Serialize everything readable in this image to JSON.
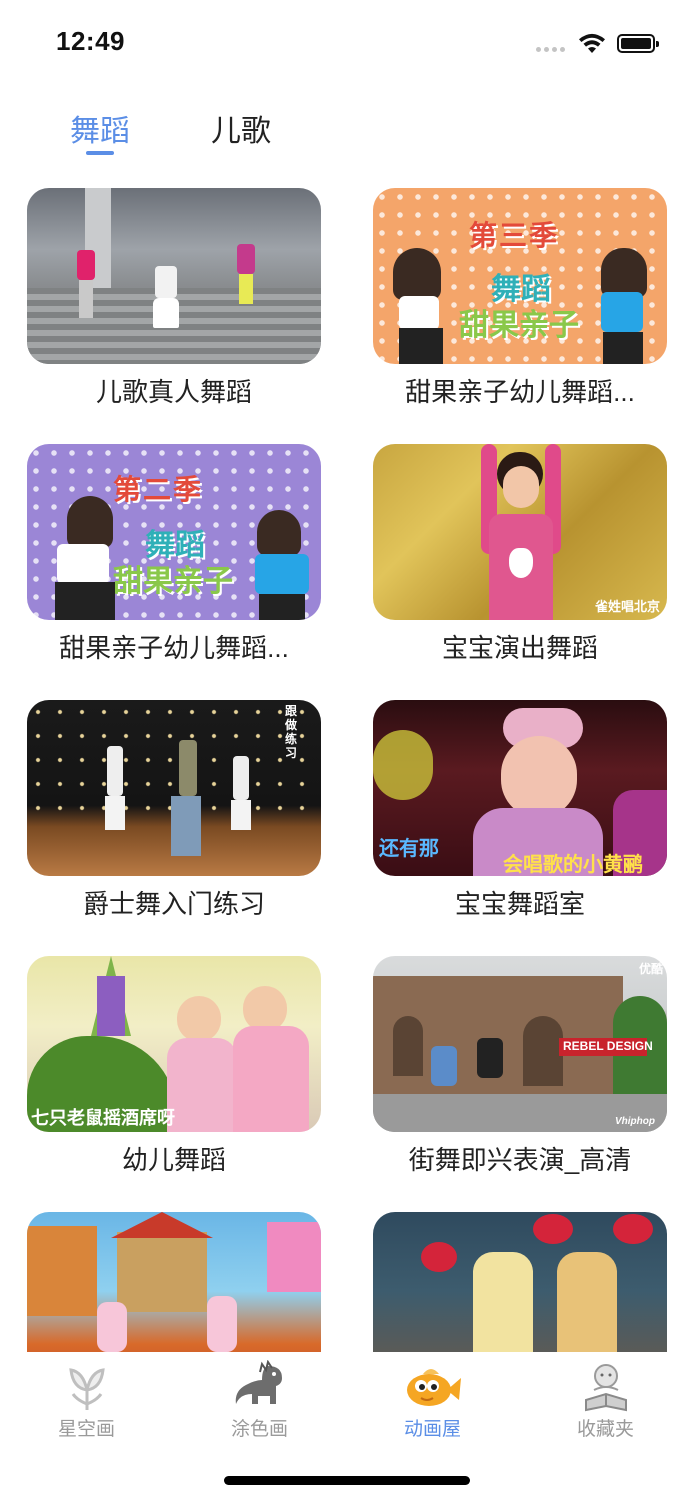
{
  "status_bar": {
    "time": "12:49"
  },
  "tabs": [
    {
      "label": "舞蹈",
      "active": true
    },
    {
      "label": "儿歌",
      "active": false
    }
  ],
  "videos": [
    {
      "title": "儿歌真人舞蹈"
    },
    {
      "title": "甜果亲子幼儿舞蹈...",
      "overlay": [
        "第三季",
        "舞蹈",
        "甜果亲子"
      ]
    },
    {
      "title": "甜果亲子幼儿舞蹈...",
      "overlay": [
        "第二季",
        "舞蹈",
        "甜果亲子"
      ]
    },
    {
      "title": "宝宝演出舞蹈",
      "overlay": [
        "雀姓唱北京"
      ]
    },
    {
      "title": "爵士舞入门练习",
      "overlay": [
        "跟做练习"
      ]
    },
    {
      "title": "宝宝舞蹈室",
      "overlay": [
        "还有那",
        "会唱歌的小黄鹂"
      ]
    },
    {
      "title": "幼儿舞蹈",
      "overlay": [
        "七只老鼠摇酒席呀"
      ]
    },
    {
      "title": "街舞即兴表演_高清",
      "overlay": [
        "优酷",
        "REBEL DESIGN",
        "Vhiphop"
      ]
    },
    {
      "title": ""
    },
    {
      "title": ""
    }
  ],
  "bottom_nav": [
    {
      "label": "星空画",
      "icon": "flower-sketch-icon",
      "active": false
    },
    {
      "label": "涂色画",
      "icon": "dinosaur-icon",
      "active": false
    },
    {
      "label": "动画屋",
      "icon": "fish-icon",
      "active": true
    },
    {
      "label": "收藏夹",
      "icon": "reading-baby-icon",
      "active": false
    }
  ],
  "colors": {
    "accent": "#5b8ee6",
    "inactive": "#9a9a9a",
    "text": "#222222"
  }
}
